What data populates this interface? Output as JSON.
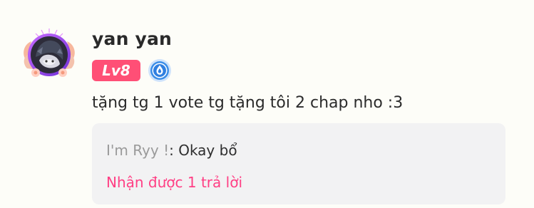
{
  "comment": {
    "username": "yan yan",
    "level_badge": "Lv8",
    "medal_icon": "droplet-medal-icon",
    "content": "tặng tg 1 vote tg tặng tôi 2 chap nho :3",
    "reply_preview": {
      "author": "I'm Ryy !",
      "separator": ": ",
      "text": "Okay bổ",
      "replies_link": "Nhận được 1 trả lời"
    }
  },
  "colors": {
    "background": "#fdfdf8",
    "level_badge": "#ff4f76",
    "medal_blue": "#3b8ee8",
    "reply_link": "#ff3f84",
    "reply_box": "#f2f2f3"
  }
}
